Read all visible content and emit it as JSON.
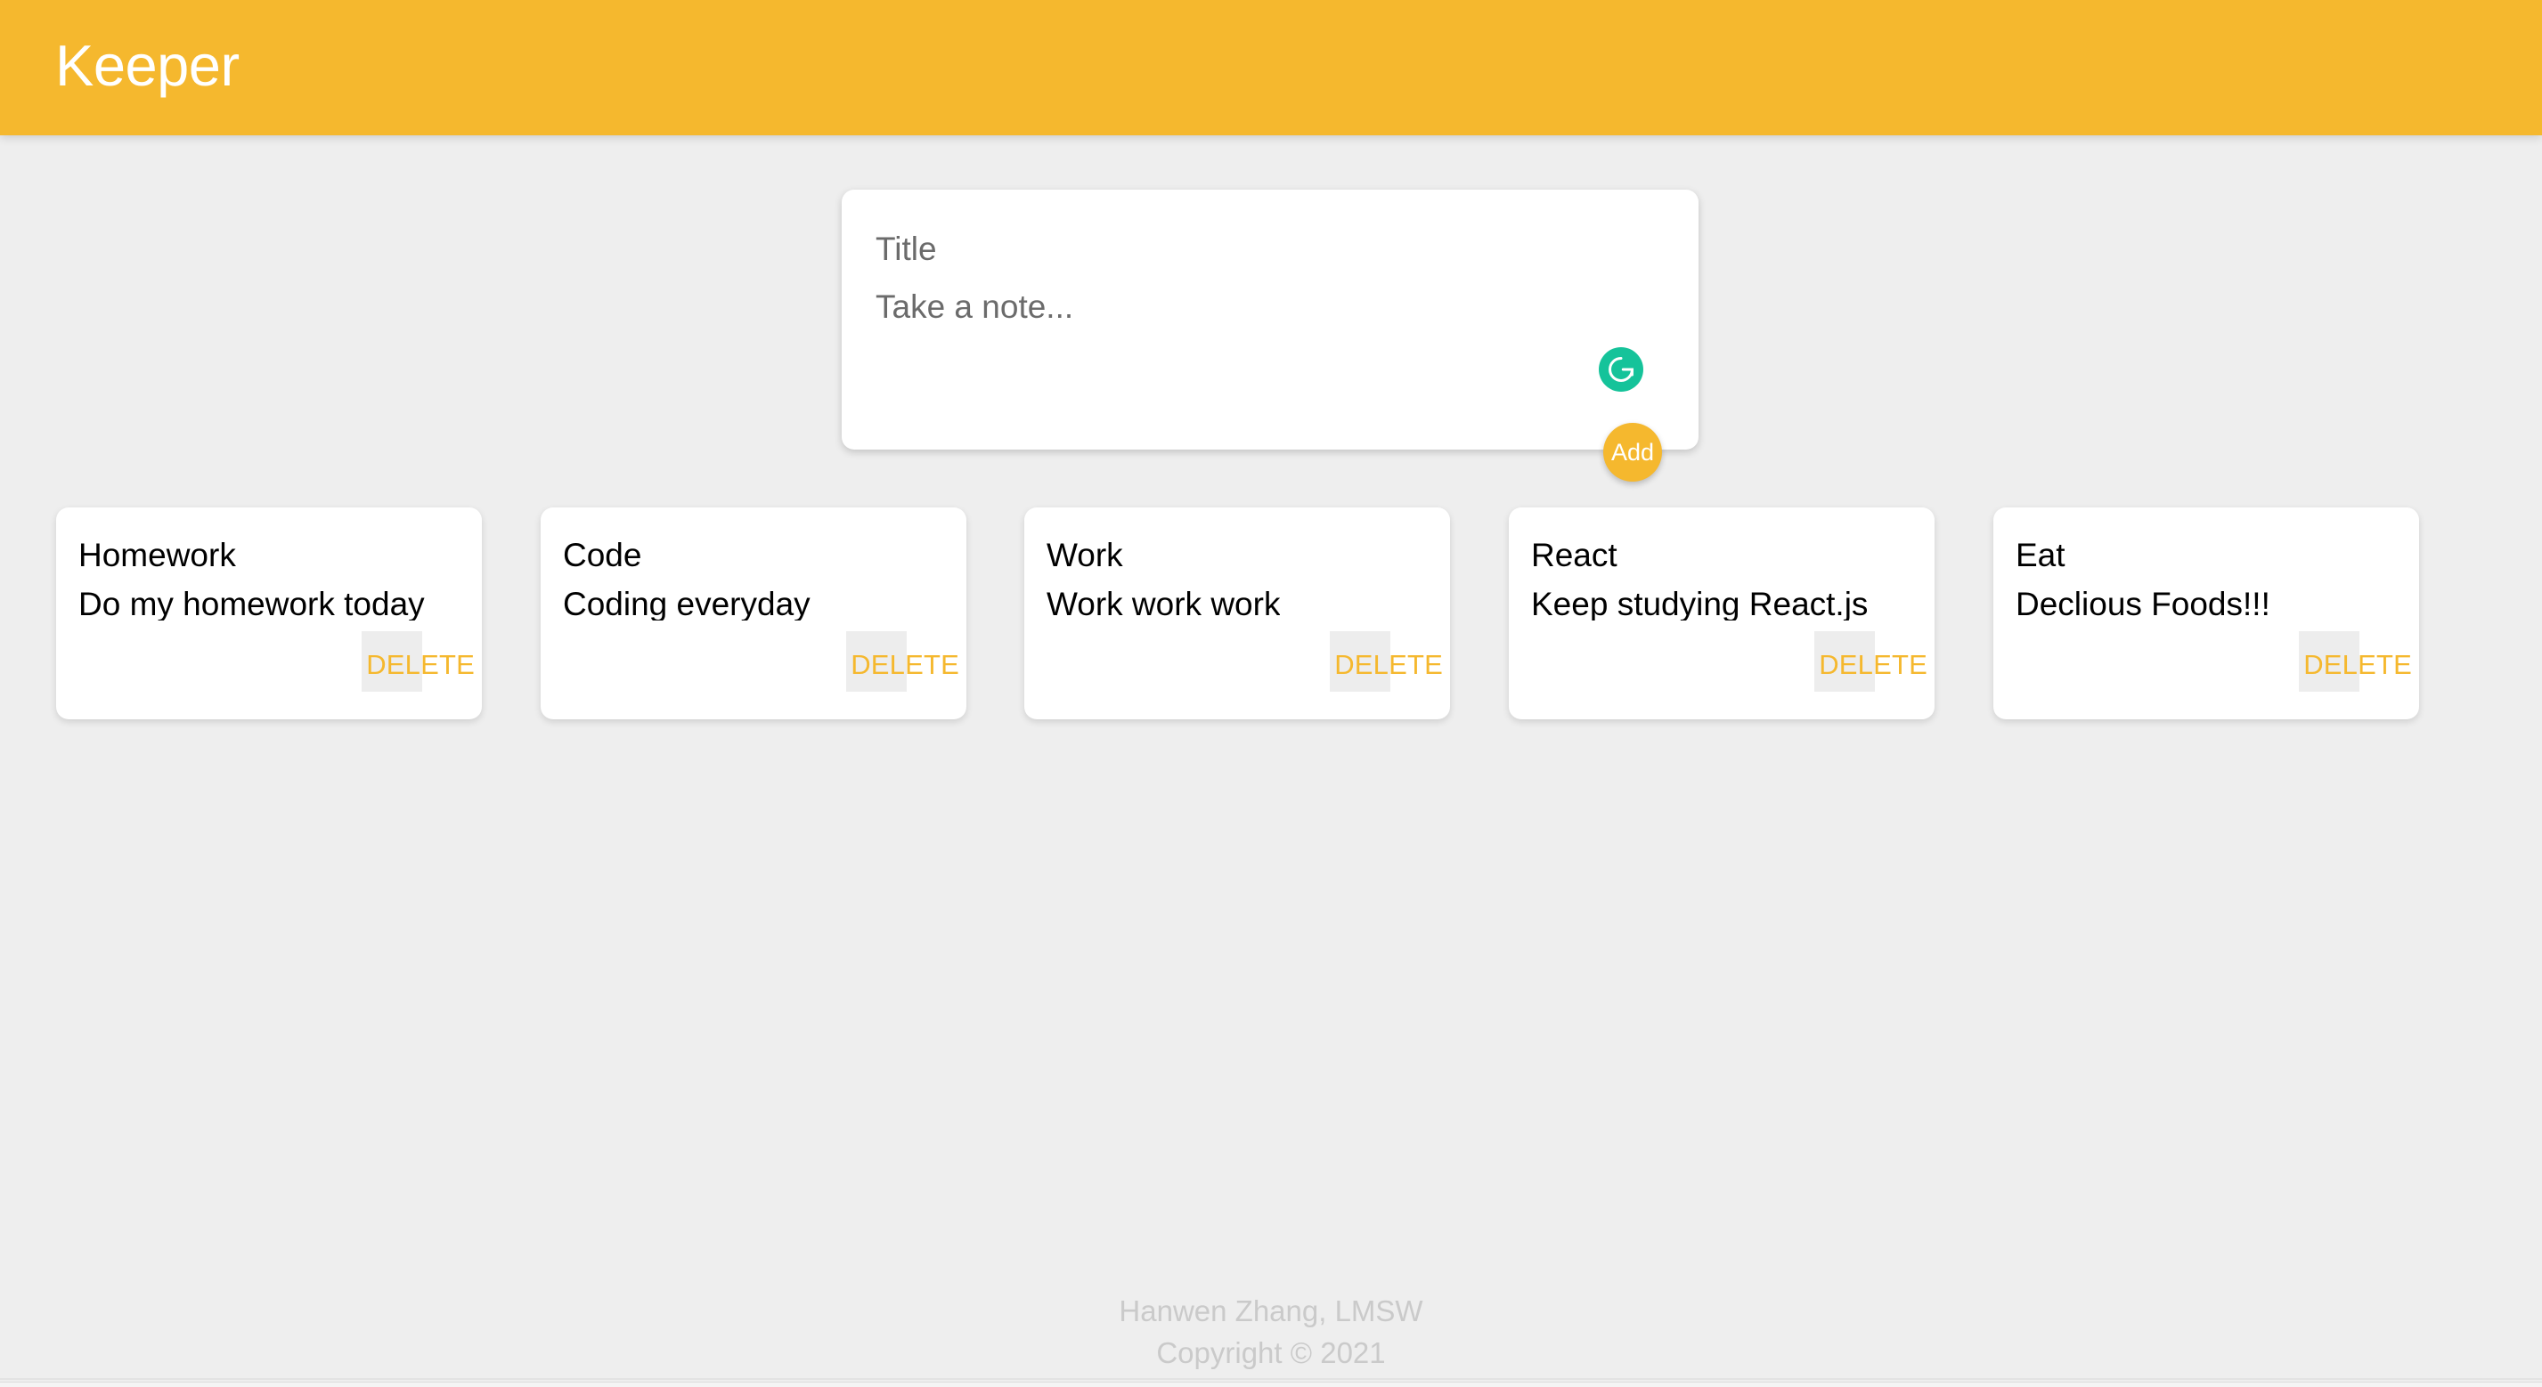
{
  "header": {
    "brand": "Keeper",
    "background_color": "#F5B82E",
    "text_color": "#FFFFFF"
  },
  "create_note": {
    "title_placeholder": "Title",
    "content_placeholder": "Take a note...",
    "title_value": "",
    "content_value": "",
    "add_button_label": "Add",
    "add_button_color": "#F5B82E",
    "grammarly_icon": "grammarly-g-icon",
    "grammarly_color": "#15C39A"
  },
  "notes": [
    {
      "title": "Homework",
      "content": "Do my homework today",
      "delete_label": "DELETE"
    },
    {
      "title": "Code",
      "content": "Coding everyday",
      "delete_label": "DELETE"
    },
    {
      "title": "Work",
      "content": "Work work work",
      "delete_label": "DELETE"
    },
    {
      "title": "React",
      "content": "Keep studying React.js",
      "delete_label": "DELETE"
    },
    {
      "title": "Eat",
      "content": "Declious Foods!!!",
      "delete_label": "DELETE"
    }
  ],
  "footer": {
    "author": "Hanwen Zhang, LMSW",
    "copyright": "Copyright © 2021"
  },
  "theme": {
    "page_background": "#EEEEEE",
    "card_background": "#FFFFFF",
    "accent": "#F5B82E",
    "delete_text_color": "#F5B82E",
    "footer_text_color": "#CACACA",
    "placeholder_color": "#6B6B6B"
  }
}
